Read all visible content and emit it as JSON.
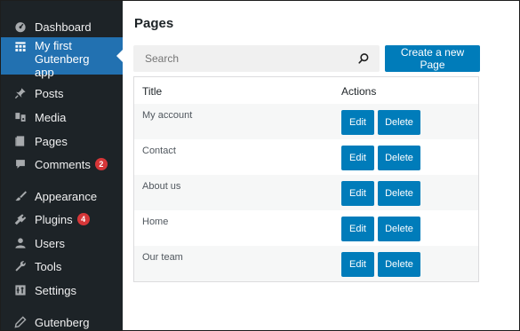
{
  "colors": {
    "sidebar_bg": "#1d2327",
    "active_bg": "#2271b1",
    "button_bg": "#007cba",
    "badge_bg": "#d63638"
  },
  "sidebar": {
    "items": [
      {
        "label": "Dashboard",
        "icon": "dashboard-icon"
      },
      {
        "label": "My first Gutenberg app",
        "icon": "grid-table-icon",
        "active": true
      },
      {
        "label": "Posts",
        "icon": "pin-icon"
      },
      {
        "label": "Media",
        "icon": "media-icon"
      },
      {
        "label": "Pages",
        "icon": "page-icon"
      },
      {
        "label": "Comments",
        "icon": "comment-icon",
        "badge": "2"
      },
      {
        "label": "Appearance",
        "icon": "paintbrush-icon"
      },
      {
        "label": "Plugins",
        "icon": "plugin-icon",
        "badge": "4"
      },
      {
        "label": "Users",
        "icon": "users-icon"
      },
      {
        "label": "Tools",
        "icon": "wrench-icon"
      },
      {
        "label": "Settings",
        "icon": "settings-icon"
      },
      {
        "label": "Gutenberg",
        "icon": "pencil-icon"
      }
    ]
  },
  "main": {
    "title": "Pages",
    "search": {
      "placeholder": "Search",
      "value": ""
    },
    "create_button": "Create a new Page",
    "table": {
      "headers": [
        "Title",
        "Actions"
      ],
      "rows": [
        {
          "title": "My account",
          "edit": "Edit",
          "delete": "Delete"
        },
        {
          "title": "Contact",
          "edit": "Edit",
          "delete": "Delete"
        },
        {
          "title": "About us",
          "edit": "Edit",
          "delete": "Delete"
        },
        {
          "title": "Home",
          "edit": "Edit",
          "delete": "Delete"
        },
        {
          "title": "Our team",
          "edit": "Edit",
          "delete": "Delete"
        }
      ]
    }
  }
}
